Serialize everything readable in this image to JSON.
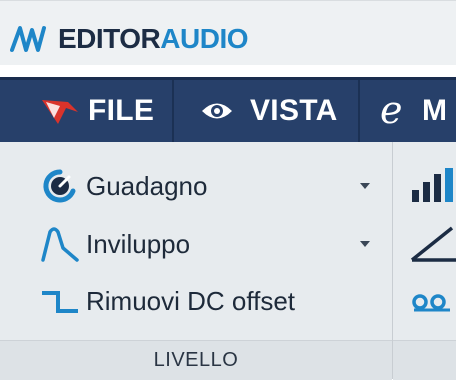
{
  "app": {
    "title_dark": "EDITOR",
    "title_accent": "AUDIO",
    "logo_icon": "waveform-logo-icon"
  },
  "menu": {
    "items": [
      {
        "label": "FILE",
        "icon": "wavelab-logo-icon"
      },
      {
        "label": "VISTA",
        "icon": "eye-icon"
      },
      {
        "label": "M",
        "icon": "edit-e-icon"
      }
    ]
  },
  "ribbon": {
    "group_label": "LIVELLO",
    "commands": [
      {
        "label": "Guadagno",
        "icon": "gain-dial-icon",
        "has_dropdown": true
      },
      {
        "label": "Inviluppo",
        "icon": "envelope-icon",
        "has_dropdown": true
      },
      {
        "label": "Rimuovi DC offset",
        "icon": "dc-offset-icon",
        "has_dropdown": false
      }
    ],
    "side_icons": [
      "level-bars-icon",
      "fade-ramp-icon",
      "loop-icon"
    ]
  },
  "colors": {
    "menu_bg": "#27406a",
    "accent": "#1e86c8",
    "panel_bg": "#e7ebee",
    "title_dark": "#1c2c44"
  }
}
